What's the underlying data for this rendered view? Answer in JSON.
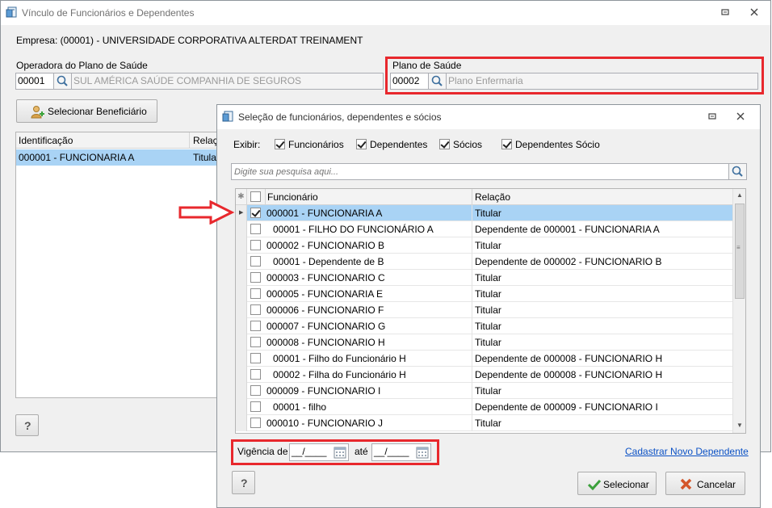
{
  "main_window": {
    "title": "Vínculo de Funcionários e Dependentes",
    "empresa": "Empresa: (00001) - UNIVERSIDADE CORPORATIVA ALTERDAT TREINAMENT",
    "operadora_label": "Operadora do Plano de Saúde",
    "operadora_code": "00001",
    "operadora_name": "SUL AMÉRICA SAÚDE COMPANHIA DE SEGUROS",
    "plano_label": "Plano de Saúde",
    "plano_code": "00002",
    "plano_name": "Plano Enfermaria",
    "select_button": "Selecionar Beneficiário",
    "grid_columns": [
      "Identificação",
      "Relação"
    ],
    "grid_rows": [
      {
        "id": "000001 - FUNCIONARIA A",
        "relacao": "Titular"
      }
    ],
    "help_button": "?"
  },
  "dialog": {
    "title": "Seleção de funcionários, dependentes e sócios",
    "exibir_label": "Exibir:",
    "filters": [
      {
        "label": "Funcionários",
        "checked": true
      },
      {
        "label": "Dependentes",
        "checked": true
      },
      {
        "label": "Sócios",
        "checked": true
      },
      {
        "label": "Dependentes Sócio",
        "checked": true
      }
    ],
    "search_placeholder": "Digite sua pesquisa aqui...",
    "columns": [
      "Funcionário",
      "Relação"
    ],
    "rows": [
      {
        "funcionario": "000001 - FUNCIONARIA A",
        "relacao": "Titular",
        "checked": true,
        "selected": true,
        "indent": false
      },
      {
        "funcionario": "00001 - FILHO DO FUNCIONÁRIO A",
        "relacao": "Dependente de 000001 - FUNCIONARIA A",
        "checked": false,
        "selected": false,
        "indent": true
      },
      {
        "funcionario": "000002 - FUNCIONARIO B",
        "relacao": "Titular",
        "checked": false,
        "selected": false,
        "indent": false
      },
      {
        "funcionario": "00001 - Dependente de B",
        "relacao": "Dependente de 000002 - FUNCIONARIO B",
        "checked": false,
        "selected": false,
        "indent": true
      },
      {
        "funcionario": "000003 - FUNCIONARIO C",
        "relacao": "Titular",
        "checked": false,
        "selected": false,
        "indent": false
      },
      {
        "funcionario": "000005 - FUNCIONARIA E",
        "relacao": "Titular",
        "checked": false,
        "selected": false,
        "indent": false
      },
      {
        "funcionario": "000006 - FUNCIONARIO F",
        "relacao": "Titular",
        "checked": false,
        "selected": false,
        "indent": false
      },
      {
        "funcionario": "000007 - FUNCIONARIO G",
        "relacao": "Titular",
        "checked": false,
        "selected": false,
        "indent": false
      },
      {
        "funcionario": "000008 - FUNCIONARIO H",
        "relacao": "Titular",
        "checked": false,
        "selected": false,
        "indent": false
      },
      {
        "funcionario": "00001 - Filho do Funcionário H",
        "relacao": "Dependente de 000008 - FUNCIONARIO H",
        "checked": false,
        "selected": false,
        "indent": true
      },
      {
        "funcionario": "00002 - Filha do Funcionário H",
        "relacao": "Dependente de 000008 - FUNCIONARIO H",
        "checked": false,
        "selected": false,
        "indent": true
      },
      {
        "funcionario": "000009 - FUNCIONARIO I",
        "relacao": "Titular",
        "checked": false,
        "selected": false,
        "indent": false
      },
      {
        "funcionario": "00001 - filho",
        "relacao": "Dependente de 000009 - FUNCIONARIO I",
        "checked": false,
        "selected": false,
        "indent": true
      },
      {
        "funcionario": "000010 - FUNCIONARIO J",
        "relacao": "Titular",
        "checked": false,
        "selected": false,
        "indent": false
      }
    ],
    "vigencia_label": "Vigência de",
    "vigencia_from": "__/____",
    "ate_label": "até",
    "vigencia_to": "__/____",
    "new_dependent_link": "Cadastrar Novo Dependente",
    "select_button": "Selecionar",
    "cancel_button": "Cancelar",
    "help_button": "?"
  },
  "colors": {
    "selection": "#a9d3f5",
    "highlight_red": "#e8282d",
    "link": "#0b51c5"
  }
}
